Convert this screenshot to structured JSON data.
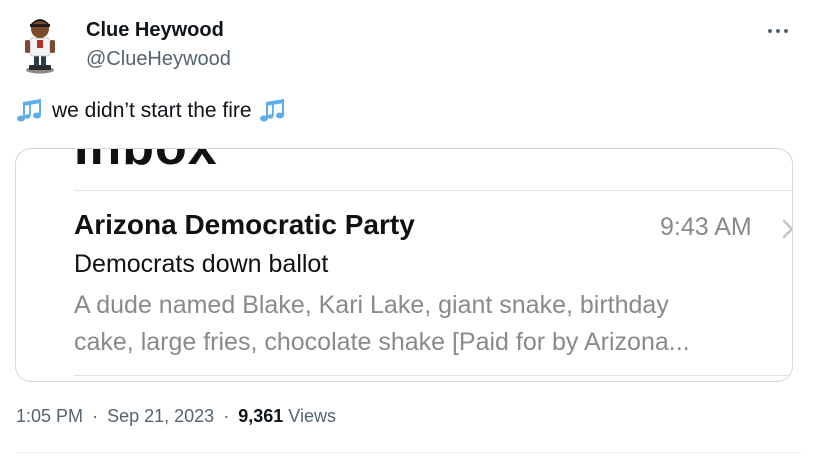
{
  "author": {
    "display_name": "Clue Heywood",
    "handle": "@ClueHeywood",
    "avatar_icon": "bobblehead-figure-avatar"
  },
  "more_button": {
    "icon": "more-horizontal-icon"
  },
  "tweet": {
    "text": "we didn’t start the fire",
    "leading_emoji": "musical-notes-icon",
    "trailing_emoji": "musical-notes-icon"
  },
  "media": {
    "header_title": "Inbox",
    "email": {
      "sender": "Arizona Democratic Party",
      "time": "9:43 AM",
      "subject": "Democrats down ballot",
      "preview_line1": "A dude named Blake, Kari Lake, giant snake, birthday",
      "preview_line2": "cake, large fries, chocolate shake [Paid for by Arizona..."
    }
  },
  "meta": {
    "time": "1:05 PM",
    "separator": "·",
    "date": "Sep 21, 2023",
    "views_count": "9,361",
    "views_label": "Views"
  },
  "colors": {
    "primary_text": "#0f1419",
    "secondary_text": "#536471",
    "card_border": "#cfd9de",
    "note_emoji": "#5dadec"
  }
}
